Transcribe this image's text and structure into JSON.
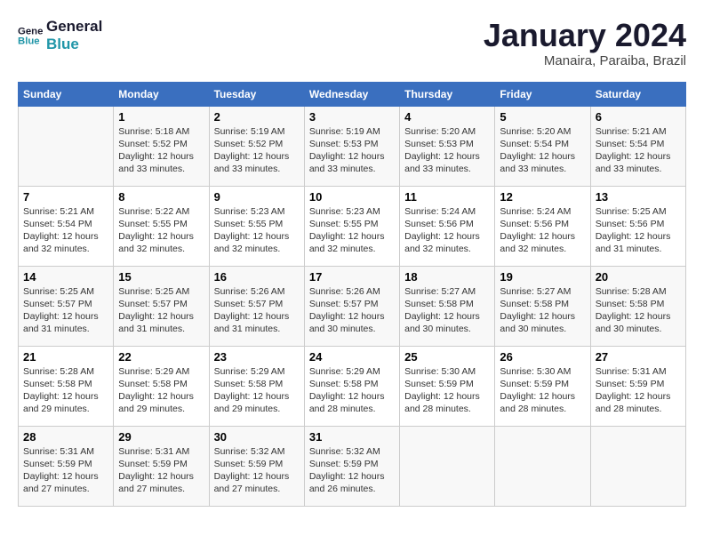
{
  "header": {
    "logo_line1": "General",
    "logo_line2": "Blue",
    "month_year": "January 2024",
    "location": "Manaira, Paraiba, Brazil"
  },
  "weekdays": [
    "Sunday",
    "Monday",
    "Tuesday",
    "Wednesday",
    "Thursday",
    "Friday",
    "Saturday"
  ],
  "weeks": [
    [
      {
        "day": "",
        "info": ""
      },
      {
        "day": "1",
        "info": "Sunrise: 5:18 AM\nSunset: 5:52 PM\nDaylight: 12 hours\nand 33 minutes."
      },
      {
        "day": "2",
        "info": "Sunrise: 5:19 AM\nSunset: 5:52 PM\nDaylight: 12 hours\nand 33 minutes."
      },
      {
        "day": "3",
        "info": "Sunrise: 5:19 AM\nSunset: 5:53 PM\nDaylight: 12 hours\nand 33 minutes."
      },
      {
        "day": "4",
        "info": "Sunrise: 5:20 AM\nSunset: 5:53 PM\nDaylight: 12 hours\nand 33 minutes."
      },
      {
        "day": "5",
        "info": "Sunrise: 5:20 AM\nSunset: 5:54 PM\nDaylight: 12 hours\nand 33 minutes."
      },
      {
        "day": "6",
        "info": "Sunrise: 5:21 AM\nSunset: 5:54 PM\nDaylight: 12 hours\nand 33 minutes."
      }
    ],
    [
      {
        "day": "7",
        "info": "Sunrise: 5:21 AM\nSunset: 5:54 PM\nDaylight: 12 hours\nand 32 minutes."
      },
      {
        "day": "8",
        "info": "Sunrise: 5:22 AM\nSunset: 5:55 PM\nDaylight: 12 hours\nand 32 minutes."
      },
      {
        "day": "9",
        "info": "Sunrise: 5:23 AM\nSunset: 5:55 PM\nDaylight: 12 hours\nand 32 minutes."
      },
      {
        "day": "10",
        "info": "Sunrise: 5:23 AM\nSunset: 5:55 PM\nDaylight: 12 hours\nand 32 minutes."
      },
      {
        "day": "11",
        "info": "Sunrise: 5:24 AM\nSunset: 5:56 PM\nDaylight: 12 hours\nand 32 minutes."
      },
      {
        "day": "12",
        "info": "Sunrise: 5:24 AM\nSunset: 5:56 PM\nDaylight: 12 hours\nand 32 minutes."
      },
      {
        "day": "13",
        "info": "Sunrise: 5:25 AM\nSunset: 5:56 PM\nDaylight: 12 hours\nand 31 minutes."
      }
    ],
    [
      {
        "day": "14",
        "info": "Sunrise: 5:25 AM\nSunset: 5:57 PM\nDaylight: 12 hours\nand 31 minutes."
      },
      {
        "day": "15",
        "info": "Sunrise: 5:25 AM\nSunset: 5:57 PM\nDaylight: 12 hours\nand 31 minutes."
      },
      {
        "day": "16",
        "info": "Sunrise: 5:26 AM\nSunset: 5:57 PM\nDaylight: 12 hours\nand 31 minutes."
      },
      {
        "day": "17",
        "info": "Sunrise: 5:26 AM\nSunset: 5:57 PM\nDaylight: 12 hours\nand 30 minutes."
      },
      {
        "day": "18",
        "info": "Sunrise: 5:27 AM\nSunset: 5:58 PM\nDaylight: 12 hours\nand 30 minutes."
      },
      {
        "day": "19",
        "info": "Sunrise: 5:27 AM\nSunset: 5:58 PM\nDaylight: 12 hours\nand 30 minutes."
      },
      {
        "day": "20",
        "info": "Sunrise: 5:28 AM\nSunset: 5:58 PM\nDaylight: 12 hours\nand 30 minutes."
      }
    ],
    [
      {
        "day": "21",
        "info": "Sunrise: 5:28 AM\nSunset: 5:58 PM\nDaylight: 12 hours\nand 29 minutes."
      },
      {
        "day": "22",
        "info": "Sunrise: 5:29 AM\nSunset: 5:58 PM\nDaylight: 12 hours\nand 29 minutes."
      },
      {
        "day": "23",
        "info": "Sunrise: 5:29 AM\nSunset: 5:58 PM\nDaylight: 12 hours\nand 29 minutes."
      },
      {
        "day": "24",
        "info": "Sunrise: 5:29 AM\nSunset: 5:58 PM\nDaylight: 12 hours\nand 28 minutes."
      },
      {
        "day": "25",
        "info": "Sunrise: 5:30 AM\nSunset: 5:59 PM\nDaylight: 12 hours\nand 28 minutes."
      },
      {
        "day": "26",
        "info": "Sunrise: 5:30 AM\nSunset: 5:59 PM\nDaylight: 12 hours\nand 28 minutes."
      },
      {
        "day": "27",
        "info": "Sunrise: 5:31 AM\nSunset: 5:59 PM\nDaylight: 12 hours\nand 28 minutes."
      }
    ],
    [
      {
        "day": "28",
        "info": "Sunrise: 5:31 AM\nSunset: 5:59 PM\nDaylight: 12 hours\nand 27 minutes."
      },
      {
        "day": "29",
        "info": "Sunrise: 5:31 AM\nSunset: 5:59 PM\nDaylight: 12 hours\nand 27 minutes."
      },
      {
        "day": "30",
        "info": "Sunrise: 5:32 AM\nSunset: 5:59 PM\nDaylight: 12 hours\nand 27 minutes."
      },
      {
        "day": "31",
        "info": "Sunrise: 5:32 AM\nSunset: 5:59 PM\nDaylight: 12 hours\nand 26 minutes."
      },
      {
        "day": "",
        "info": ""
      },
      {
        "day": "",
        "info": ""
      },
      {
        "day": "",
        "info": ""
      }
    ]
  ]
}
